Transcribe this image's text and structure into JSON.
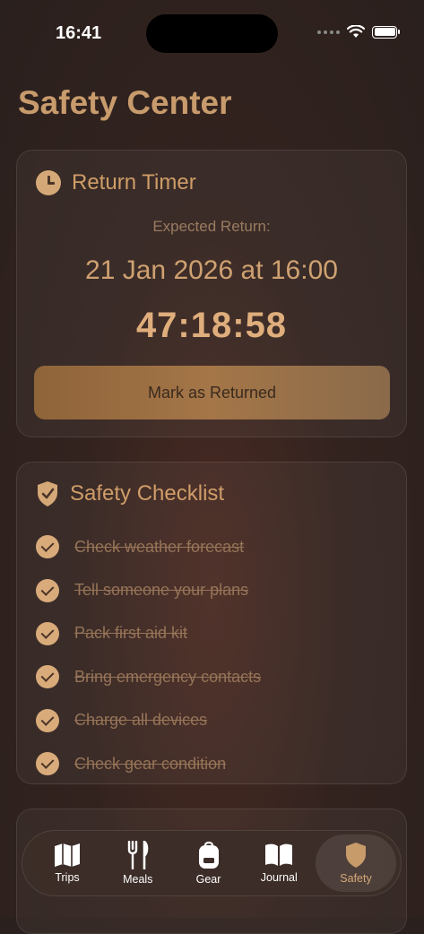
{
  "status_bar": {
    "time": "16:41"
  },
  "page": {
    "title": "Safety Center"
  },
  "return_timer": {
    "title": "Return Timer",
    "expected_label": "Expected Return:",
    "expected_date": "21 Jan 2026 at 16:00",
    "countdown": "47:18:58",
    "button_label": "Mark as Returned"
  },
  "checklist": {
    "title": "Safety Checklist",
    "items": [
      {
        "label": "Check weather forecast",
        "checked": true
      },
      {
        "label": "Tell someone your plans",
        "checked": true
      },
      {
        "label": "Pack first aid kit",
        "checked": true
      },
      {
        "label": "Bring emergency contacts",
        "checked": true
      },
      {
        "label": "Charge all devices",
        "checked": true
      },
      {
        "label": "Check gear condition",
        "checked": true
      }
    ]
  },
  "tabs": [
    {
      "label": "Trips",
      "icon": "map-icon"
    },
    {
      "label": "Meals",
      "icon": "fork-knife-icon"
    },
    {
      "label": "Gear",
      "icon": "backpack-icon"
    },
    {
      "label": "Journal",
      "icon": "book-icon"
    },
    {
      "label": "Safety",
      "icon": "shield-icon",
      "selected": true
    }
  ],
  "colors": {
    "accent": "#d5a877",
    "background": "#2f221e"
  }
}
